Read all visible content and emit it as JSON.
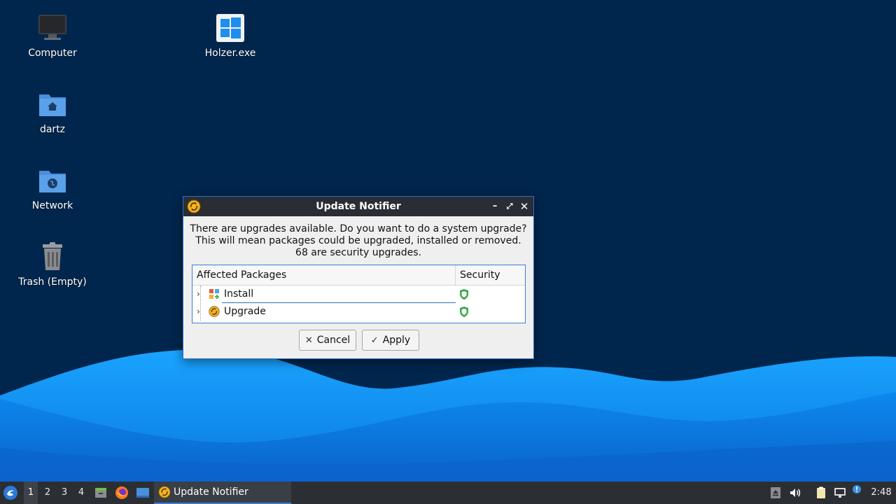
{
  "desktop": {
    "icons": [
      {
        "label": "Computer"
      },
      {
        "label": "Holzer.exe"
      },
      {
        "label": "dartz"
      },
      {
        "label": "Network"
      },
      {
        "label": "Trash (Empty)"
      }
    ]
  },
  "dialog": {
    "title": "Update Notifier",
    "message_lines": [
      "There are upgrades available. Do you want to do a system upgrade?",
      "This will mean packages could be upgraded, installed or removed.",
      "68 are security upgrades."
    ],
    "table": {
      "columns": [
        "Affected Packages",
        "Security"
      ],
      "rows": [
        {
          "name": "Install"
        },
        {
          "name": "Upgrade"
        }
      ]
    },
    "buttons": {
      "cancel": "Cancel",
      "apply": "Apply"
    },
    "window_controls": {
      "minimize": "–",
      "maximize": "⤢",
      "close": "✕"
    }
  },
  "taskbar": {
    "workspaces": [
      "1",
      "2",
      "3",
      "4"
    ],
    "active_workspace": "1",
    "task_label": "Update Notifier",
    "clock": "2:48"
  },
  "colors": {
    "desktop_bg": "#01264d",
    "wave_light": "#0a8ef0",
    "titlebar": "#2a2d33",
    "accent": "#3a7fd0",
    "security_green": "#3aa845"
  }
}
